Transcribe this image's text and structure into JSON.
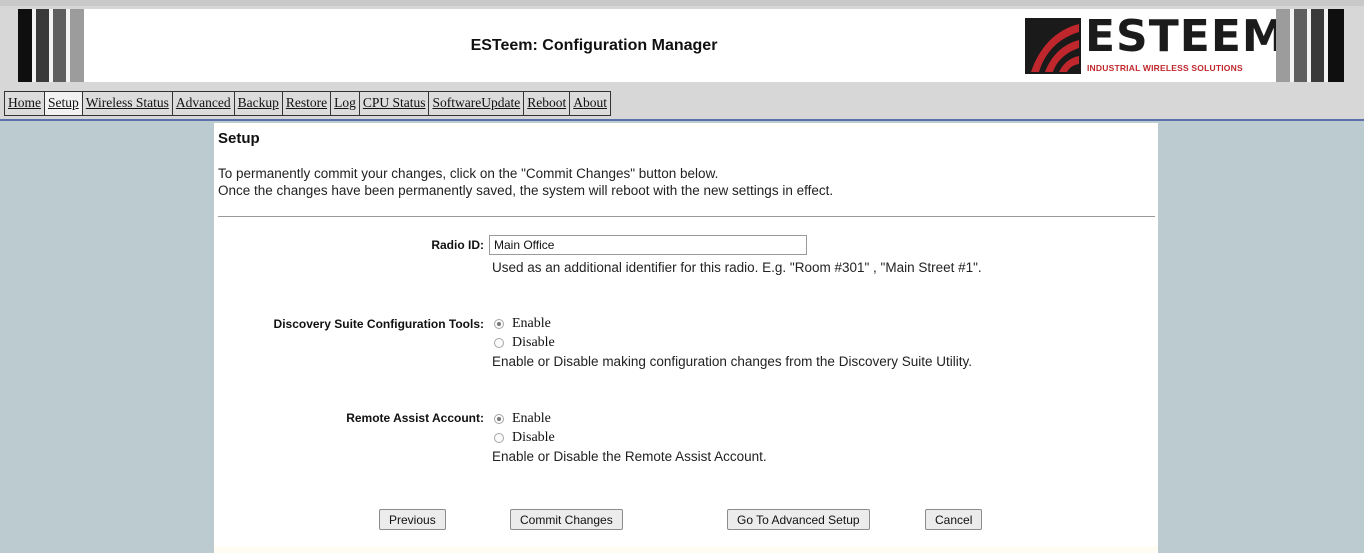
{
  "header": {
    "title": "ESTeem: Configuration Manager",
    "logo_text": "ESTEEM",
    "logo_tagline": "INDUSTRIAL WIRELESS SOLUTIONS"
  },
  "nav": {
    "items": [
      {
        "label": "Home"
      },
      {
        "label": "Setup"
      },
      {
        "label": "Wireless Status"
      },
      {
        "label": "Advanced"
      },
      {
        "label": "Backup"
      },
      {
        "label": "Restore"
      },
      {
        "label": "Log"
      },
      {
        "label": "CPU Status"
      },
      {
        "label": "SoftwareUpdate"
      },
      {
        "label": "Reboot"
      },
      {
        "label": "About"
      }
    ],
    "active": "Setup"
  },
  "page": {
    "title": "Setup",
    "intro_line1": "To permanently commit your changes, click on the \"Commit Changes\" button below.",
    "intro_line2": "Once the changes have been permanently saved, the system will reboot with the new settings in effect."
  },
  "form": {
    "radio_id": {
      "label": "Radio ID:",
      "value": "Main Office",
      "help": "Used as an additional identifier for this radio. E.g. \"Room #301\" , \"Main Street #1\"."
    },
    "discovery": {
      "label": "Discovery Suite Configuration Tools:",
      "options": [
        "Enable",
        "Disable"
      ],
      "selected": "Enable",
      "help": "Enable or Disable making configuration changes from the Discovery Suite Utility."
    },
    "remote_assist": {
      "label": "Remote Assist Account:",
      "options": [
        "Enable",
        "Disable"
      ],
      "selected": "Enable",
      "help": "Enable or Disable the Remote Assist Account."
    }
  },
  "buttons": {
    "previous": "Previous",
    "commit": "Commit Changes",
    "advanced": "Go To Advanced Setup",
    "cancel": "Cancel"
  },
  "colors": {
    "page_background": "#bccbd0",
    "header_background": "#d7d7d7",
    "nav_divider": "#5b6fa8",
    "logo_accent": "#c0272d"
  }
}
